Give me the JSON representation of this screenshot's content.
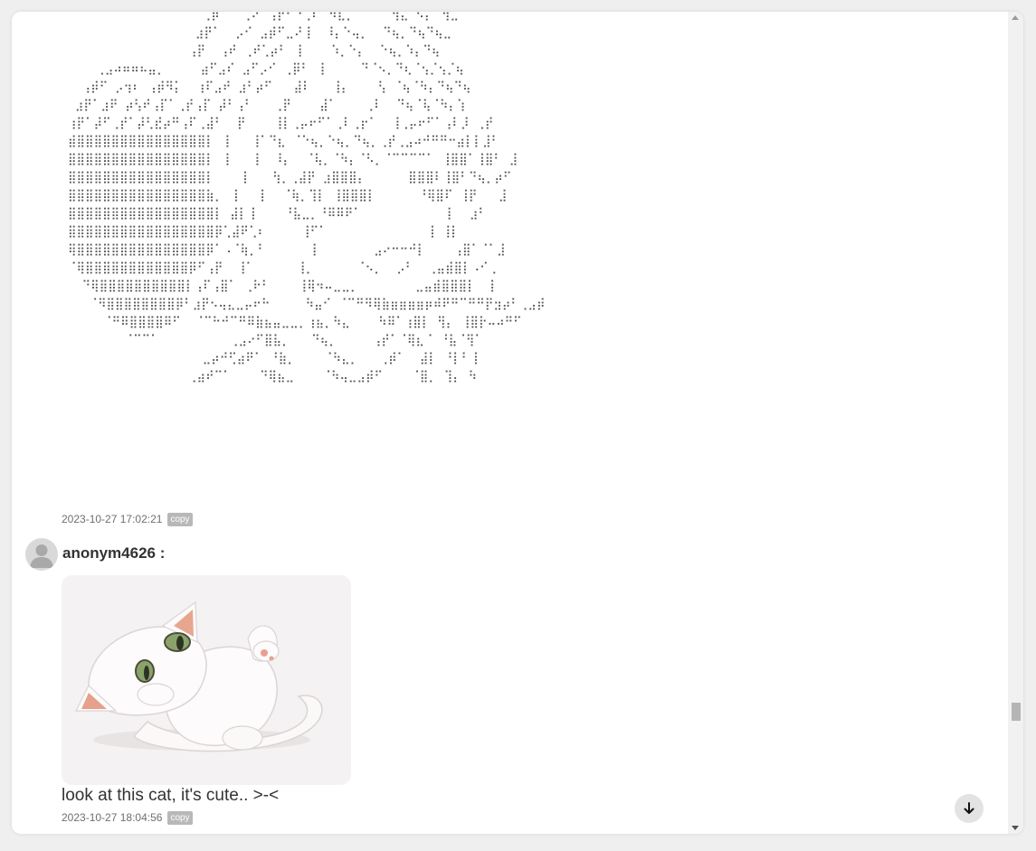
{
  "ascii_art": {
    "lines": [
      "                   ⢀⡾⠁  ⢀⠔⠁⢠⡞⠋⠙⢀⠏⠉⠻⣆⡀    ⠈⢳⣄ ⠣⡄⠈⢳⣀",
      "                  ⣰⡟⠁  ⡠⠊ ⣠⡾⠋⣀⠜⢸  ⠸⡄⠑⢤⡀  ⠙⢦⡀⠙⢦⠙⢦⣀",
      "                 ⢠⡟  ⢠⠞ ⢀⠞⢁⡴⠃ ⢸    ⠱⡀⠑⡄  ⠑⢦⡀⠱⡄⠙⢦",
      "    ⢀⣠⠴⠶⠶⠦⣤⡀     ⣴⠋⣠⠎ ⣠⠋⡠⠊ ⢀⡿⠃ ⢸     ⠙⠈⠢⡀⠙⢆⠈⢢⡈⢢⡈⢦",
      "  ⢠⡾⠋ ⡠⢲⠆ ⢠⡾⠻⡅  ⢰⠏⣠⠞ ⣰⠃⡴⠋   ⣼⠇   ⢸⡄    ⢣ ⠈⢦⠈⠳⡄⠙⢦⠙⢦",
      " ⣰⡟⠁⣰⠟ ⡴⢣⠞⢠⡏⠁⢀⡞⢠⡏ ⡼⠃⢠⠃   ⢀⡟    ⣼⠁    ⢀⠇  ⠙⢦⠈⢧⠈⠳⡄⢱",
      "⢰⡟⠁⡼⠋⢀⡞⠁⡼⢃⣞⡴⠛⢠⠏⢀⣼⠃  ⡟    ⢸⡇⢀⡤⠖⠋⠁⢀⠇⢀⡖⠁  ⢸⢀⡤⠖⠋⠁⢠⠇⡸ ⢀⡞",
      "⣾⣿⣿⣿⣿⣿⣿⣿⣿⣿⣿⣿⣿⣿⣿⣿⡇ ⢸   ⢸⠁⠙⣆ ⠈⠑⢦⡀⠑⢦⡀⠙⢦⡀⢀⡞⢀⣠⠴⠚⠛⠛⠒⣴⡇⡇⣸⠃",
      "⣿⣿⣿⣿⣿⣿⣿⣿⣿⣿⣿⣿⣿⣿⣿⣿⡇ ⢸   ⢸  ⠸⡄  ⠈⢧⡀⠈⠳⡄⠈⠣⡀⠈⠉⠉⠉⠉⠁ ⢸⣿⣿⠁⢸⣿⠃ ⣸",
      "⣿⣿⣿⣿⣿⣿⣿⣿⣿⣿⣿⣿⣿⣿⣿⣿⡇    ⡇   ⢳⡀⢀⣼⡟ ⣰⣿⣿⣿⡄      ⣿⣿⣿⠇⢸⣿⠃⠙⢦⡀⡴⠋",
      "⣿⣿⣿⣿⣿⣿⣿⣿⣿⣿⣿⣿⣿⣿⣿⣿⣷⡀ ⢸   ⡇  ⠈⢷⡀⢹⡇ ⢸⣿⣿⣿⡇      ⠘⢿⣿⠏ ⢸⡟   ⣸",
      "⣿⣿⣿⣿⣿⣿⣿⣿⣿⣿⣿⣿⣿⣿⣿⣿⣿⡇ ⣼⡇⢸    ⠘⣧⣀⡀⠘⠿⠿⠟⠁            ⡇  ⣰⠃",
      "⣿⣿⣿⣿⣿⣿⣿⣿⣿⣿⣿⣿⣿⣿⣿⣿⣿⡿⢁⣼⠟⢁⠆     ⢸⠋⠁              ⢸ ⢸⡇",
      "⢿⣿⣿⣿⣿⣿⣿⣿⣿⣿⣿⣿⣿⣿⣿⣿⡿⠁⠠⠈⢷⡀⠃      ⢸        ⣠⠔⠒⠒⠚⡇    ⢠⣿⠁⠈⠁⣸",
      "⠈⢿⣿⣿⣿⣿⣿⣿⣿⣿⣿⣿⣿⣿⡿⠋⢠⡟  ⢸⠁      ⢸⡀      ⠈⠢⡀  ⡠⠃  ⢀⣤⣾⣿⡇⠠⠊⢀",
      "  ⠙⢿⣿⣿⣿⣿⣿⣿⣿⣿⣿⣿⡇⢠⠏⢠⣿⠁ ⢀⠗⠃    ⢸⢿⠲⠤⣀⣀⡀        ⣀⣤⣾⣿⣿⣿⡇  ⡇",
      "   ⠈⠻⣿⣿⣿⣿⣿⣿⣿⣿⡿⠃⣰⡟⠢⢤⣄⣀⡤⠖⠓     ⠳⣤⠊ ⠈⠉⠛⠻⢿⣷⣶⣶⣶⣶⡶⠾⠟⠛⠉⠛⠛⡟⣲⡴⠃⢀⣠⡾",
      "     ⠈⠛⠿⣿⣿⣿⣿⠿⠋  ⠈⠉⠓⠚⠉⠛⠿⣷⣦⣤⣀⣀⡀⢰⣦⡀⠳⣄    ⠳⠿⠁⢰⣿⡇ ⢻⡄ ⢸⣿⡗⠤⠴⠛⠋",
      "        ⠈⠉⠉⠁          ⢀⣠⠔⠋⣿⣧⡀   ⠙⢦⡀     ⢠⡞⠁⠈⢿⣆⠈ ⠘⣧⠈⢻⠁",
      "                   ⣀⡴⠚⢋⣴⠟⠁ ⠘⣷⡀    ⠈⠳⣄⡀   ⢀⡾⠁  ⣼⡇ ⠘⡇⠃⢸",
      "                 ⢀⣴⠞⠉⠁    ⠙⢿⣦⣀    ⠈⠳⢤⣀⣠⡾⠋    ⠈⣿⡀ ⢹⡄ ⠳"
    ]
  },
  "first_message": {
    "timestamp": "2023-10-27 17:02:21",
    "copy_label": "copy"
  },
  "second_message": {
    "username": "anonym4626 :",
    "avatar_icon": "user-avatar-icon",
    "image_icon": "cat-image",
    "text": "look at this cat, it's cute.. >-<",
    "timestamp": "2023-10-27 18:04:56",
    "copy_label": "copy"
  },
  "scroll_down_icon": "arrow-down-icon",
  "colors": {
    "background": "#efefef",
    "panel": "#ffffff",
    "copy_badge": "#b8b8b8",
    "image_bg": "#f4f2f2"
  }
}
